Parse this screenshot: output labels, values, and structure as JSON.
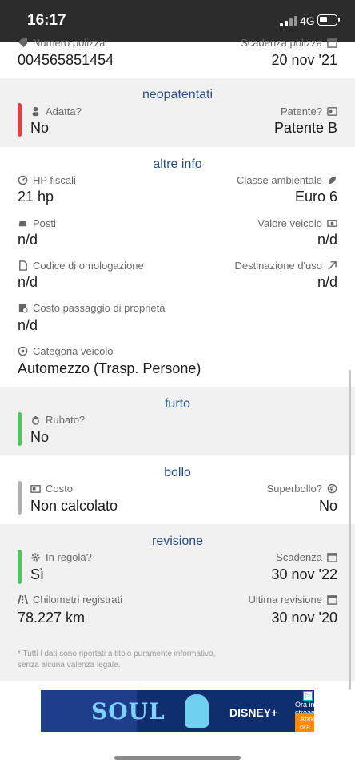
{
  "status_bar": {
    "time": "16:17",
    "network": "4G"
  },
  "polizza": {
    "numero_label": "Numero polizza",
    "numero_value": "004565851454",
    "scadenza_label": "Scadenza polizza",
    "scadenza_value": "20 nov '21"
  },
  "neopatentati": {
    "title": "neopatentati",
    "status_color": "#e04040",
    "adatta_label": "Adatta?",
    "adatta_value": "No",
    "patente_label": "Patente?",
    "patente_value": "Patente B"
  },
  "altre_info": {
    "title": "altre info",
    "hp_label": "HP fiscali",
    "hp_value": "21 hp",
    "classe_label": "Classe ambientale",
    "classe_value": "Euro 6",
    "posti_label": "Posti",
    "posti_value": "n/d",
    "valore_label": "Valore veicolo",
    "valore_value": "n/d",
    "omologazione_label": "Codice di omologazione",
    "omologazione_value": "n/d",
    "destinazione_label": "Destinazione d'uso",
    "destinazione_value": "n/d",
    "passaggio_label": "Costo passaggio di proprietà",
    "passaggio_value": "n/d",
    "categoria_label": "Categoria veicolo",
    "categoria_value": "Automezzo (Trasp. Persone)"
  },
  "furto": {
    "title": "furto",
    "status_color": "#52c25e",
    "rubato_label": "Rubato?",
    "rubato_value": "No"
  },
  "bollo": {
    "title": "bollo",
    "status_color": "#b0b0b0",
    "costo_label": "Costo",
    "costo_value": "Non calcolato",
    "superbollo_label": "Superbollo?",
    "superbollo_value": "No"
  },
  "revisione": {
    "title": "revisione",
    "status_color": "#52c25e",
    "regola_label": "In regola?",
    "regola_value": "Sì",
    "scadenza_label": "Scadenza",
    "scadenza_value": "30 nov '22",
    "km_label": "Chilometri registrati",
    "km_value": "78.227 km",
    "ultima_label": "Ultima revisione",
    "ultima_value": "30 nov '20"
  },
  "footnote": "* Tutti i dati sono riportati a titolo puramente informativo, senza alcuna valenza legale.",
  "ad": {
    "title": "SOUL",
    "brand": "DISNEY+",
    "streaming": "Ora in streaming",
    "cta": "Abbonati ora"
  }
}
